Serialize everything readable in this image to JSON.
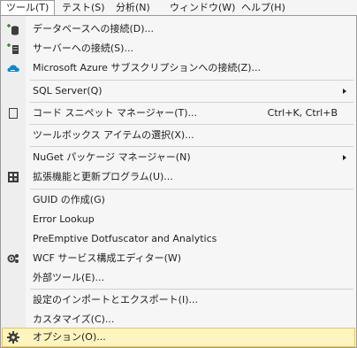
{
  "menubar": {
    "items": [
      {
        "label": "ツール(T)"
      },
      {
        "label": "テスト(S)"
      },
      {
        "label": "分析(N)"
      },
      {
        "label": "ウィンドウ(W)"
      },
      {
        "label": "ヘルプ(H)"
      }
    ]
  },
  "menu": {
    "items": [
      {
        "label": "データベースへの接続(D)...",
        "icon": "connect-database-icon"
      },
      {
        "label": "サーバーへの接続(S)...",
        "icon": "connect-server-icon"
      },
      {
        "label": "Microsoft Azure サブスクリプションへの接続(Z)...",
        "icon": "azure-cloud-icon"
      },
      {
        "label": "SQL Server(Q)",
        "submenu": true
      },
      {
        "label": "コード スニペット マネージャー(T)...",
        "shortcut": "Ctrl+K, Ctrl+B",
        "icon": "code-snippet-icon"
      },
      {
        "label": "ツールボックス アイテムの選択(X)..."
      },
      {
        "label": "NuGet パッケージ マネージャー(N)",
        "submenu": true
      },
      {
        "label": "拡張機能と更新プログラム(U)...",
        "icon": "extensions-icon"
      },
      {
        "label": "GUID の作成(G)"
      },
      {
        "label": "Error Lookup"
      },
      {
        "label": "PreEmptive Dotfuscator and Analytics"
      },
      {
        "label": "WCF サービス構成エディター(W)",
        "icon": "wcf-config-icon"
      },
      {
        "label": "外部ツール(E)..."
      },
      {
        "label": "設定のインポートとエクスポート(I)..."
      },
      {
        "label": "カスタマイズ(C)..."
      },
      {
        "label": "オプション(O)...",
        "icon": "gear-icon",
        "highlighted": true
      }
    ]
  },
  "colors": {
    "highlight_bg": "#fdf4bf",
    "highlight_border": "#e5c365",
    "azure_blue": "#0089d6"
  }
}
